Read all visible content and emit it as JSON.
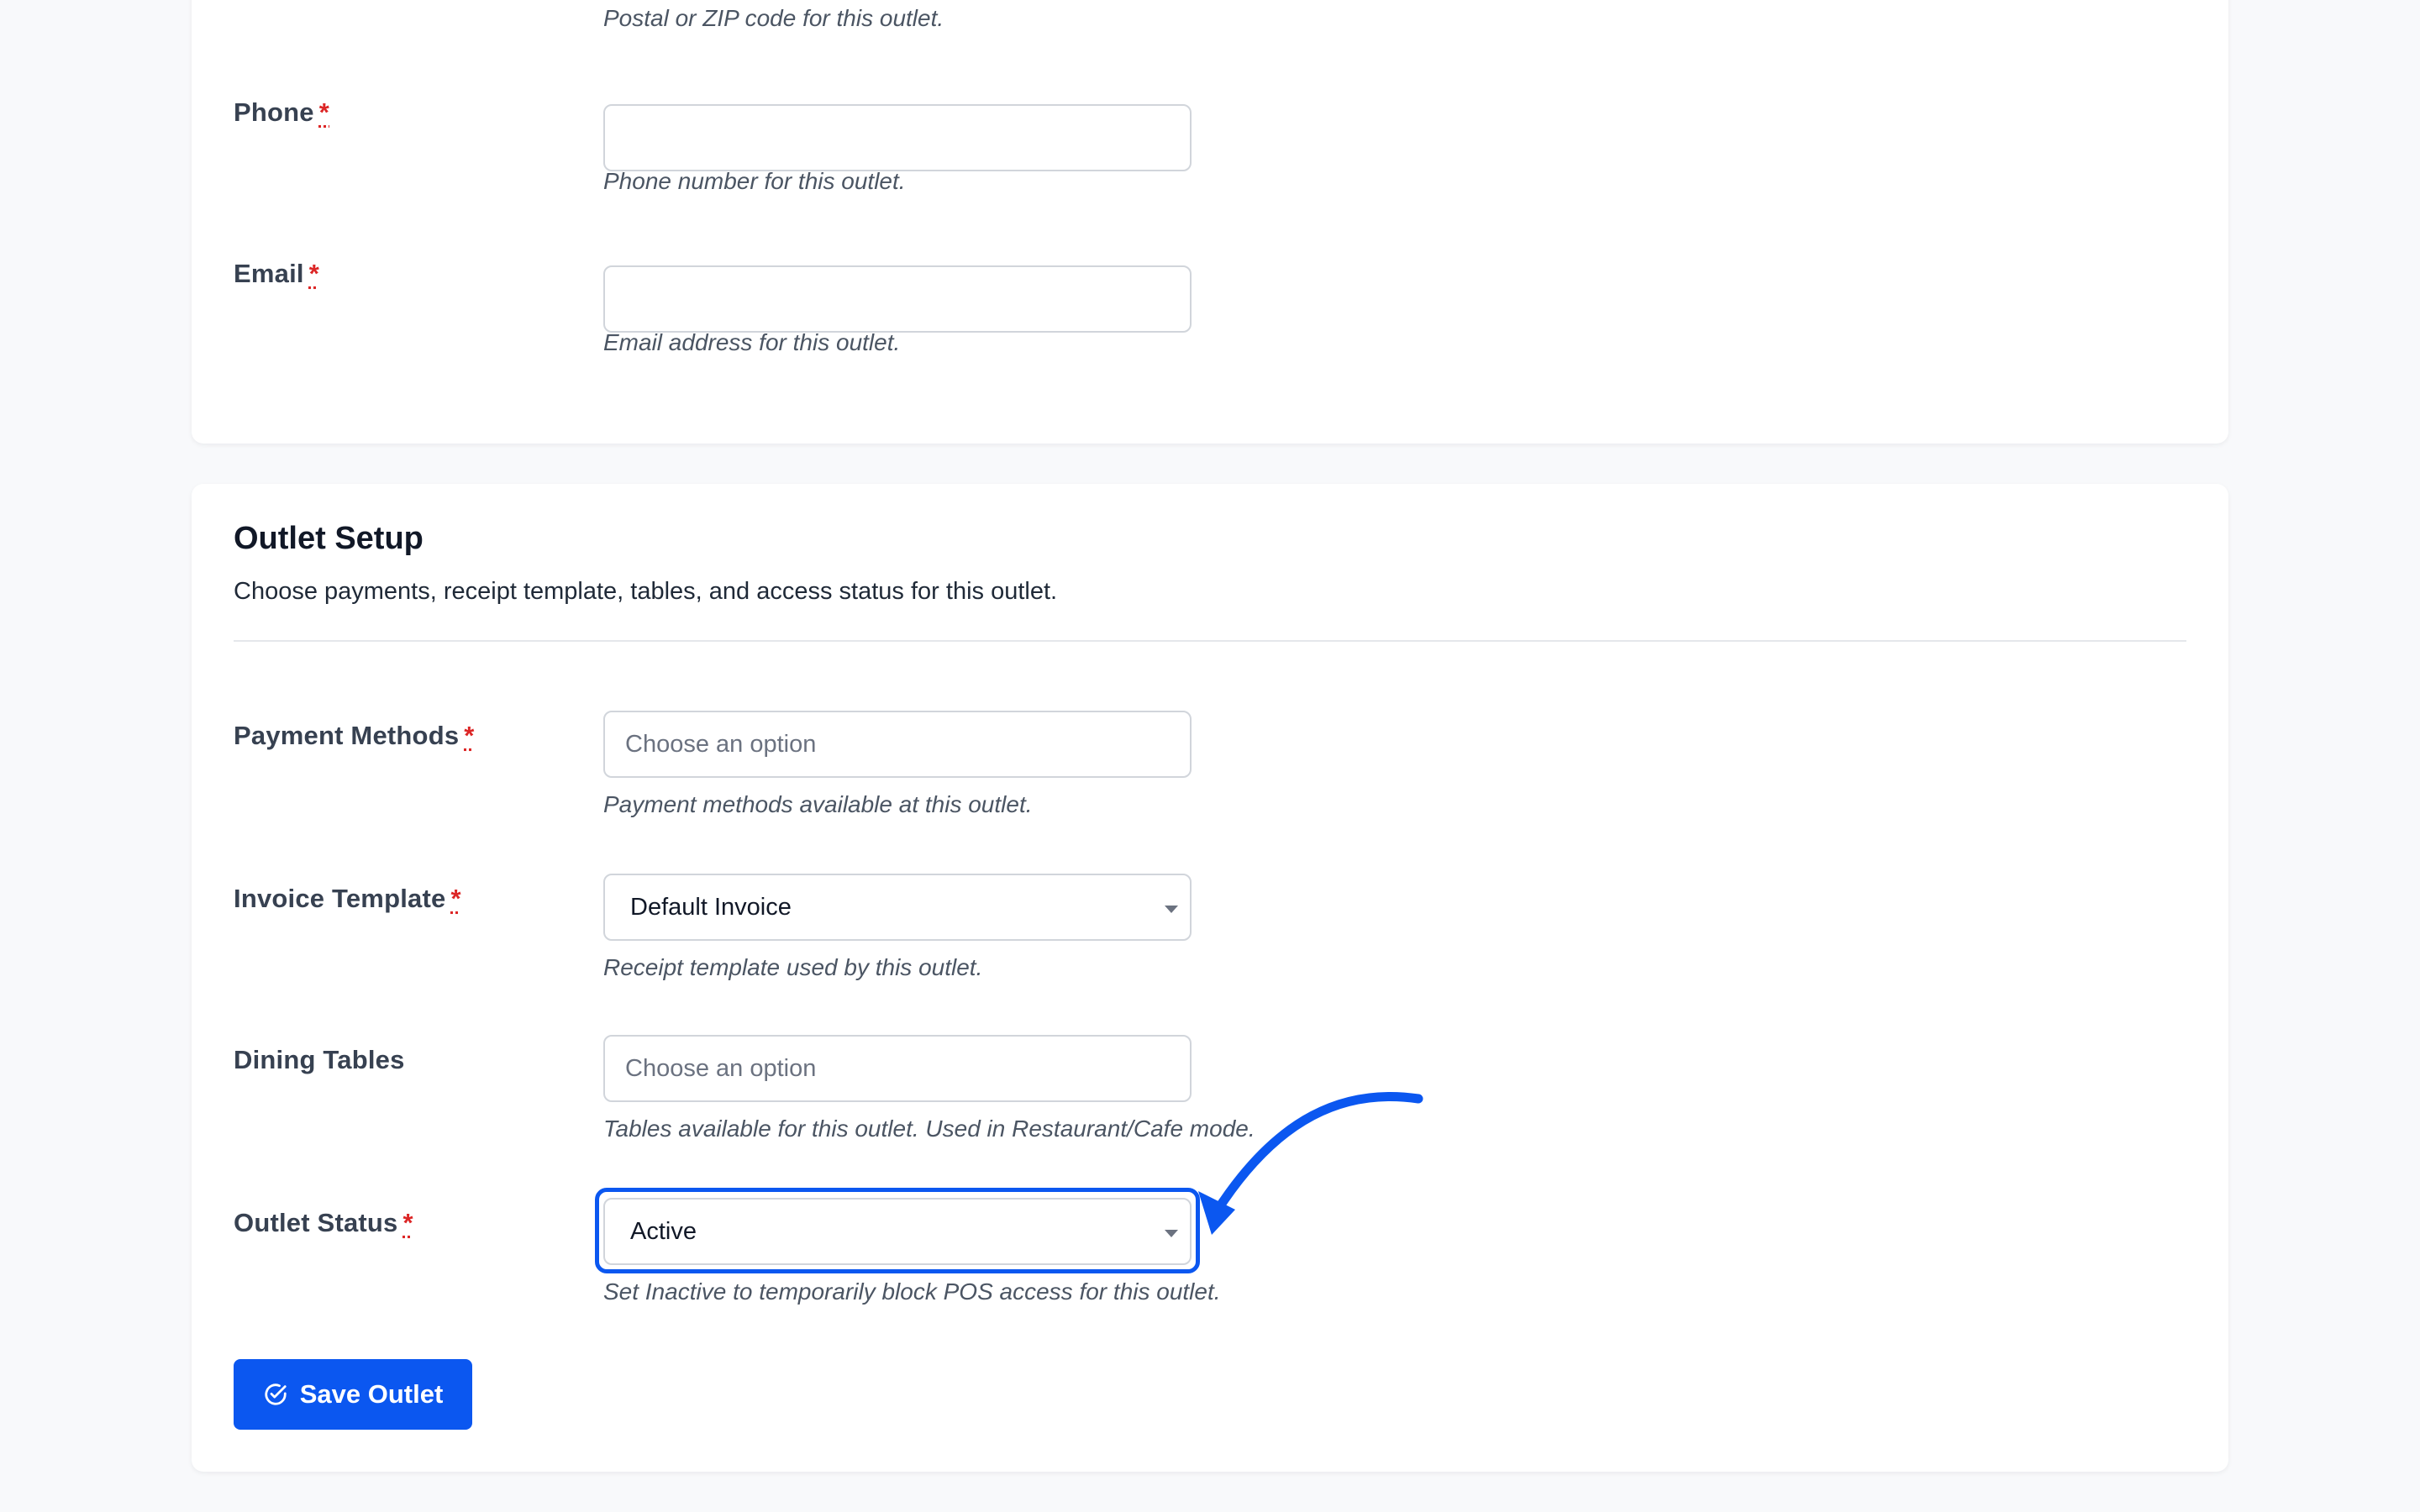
{
  "contact_section": {
    "postal": {
      "help": "Postal or ZIP code for this outlet."
    },
    "phone": {
      "label": "Phone",
      "required_mark": "*",
      "value": "",
      "help": "Phone number for this outlet."
    },
    "email": {
      "label": "Email",
      "required_mark": "*",
      "value": "",
      "help": "Email address for this outlet."
    }
  },
  "setup_section": {
    "title": "Outlet Setup",
    "description": "Choose payments, receipt template, tables, and access status for this outlet.",
    "payment_methods": {
      "label": "Payment Methods",
      "required_mark": "*",
      "placeholder": "Choose an option",
      "help": "Payment methods available at this outlet."
    },
    "invoice_template": {
      "label": "Invoice Template",
      "required_mark": "*",
      "selected": "Default Invoice",
      "help": "Receipt template used by this outlet."
    },
    "dining_tables": {
      "label": "Dining Tables",
      "placeholder": "Choose an option",
      "help": "Tables available for this outlet. Used in Restaurant/Cafe mode."
    },
    "outlet_status": {
      "label": "Outlet Status",
      "required_mark": "*",
      "selected": "Active",
      "help": "Set Inactive to temporarily block POS access for this outlet."
    }
  },
  "actions": {
    "save_label": "Save Outlet",
    "save_icon": "check-circle-icon"
  },
  "colors": {
    "primary": "#0b57f0",
    "required": "#dc2626",
    "page_background": "#f8f9fb"
  }
}
